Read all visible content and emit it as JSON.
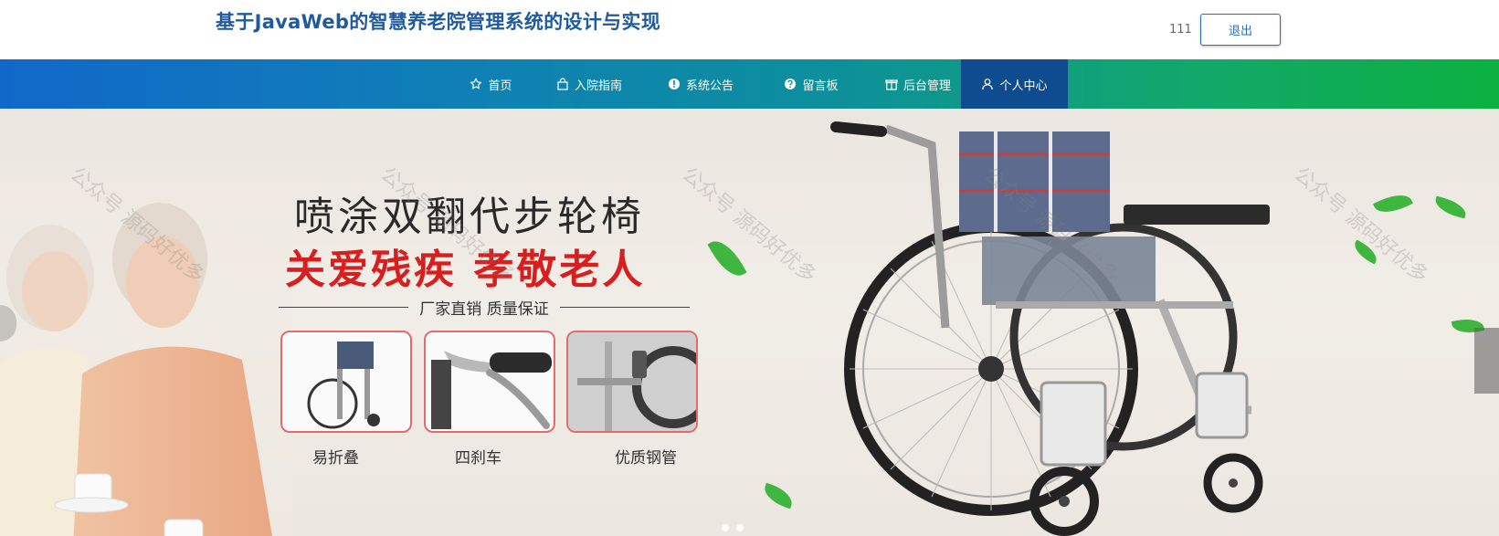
{
  "header": {
    "title": "基于JavaWeb的智慧养老院管理系统的设计与实现",
    "username": "111",
    "logout_label": "退出"
  },
  "nav": {
    "items": [
      {
        "label": "首页",
        "icon": "star-icon"
      },
      {
        "label": "入院指南",
        "icon": "bag-icon"
      },
      {
        "label": "系统公告",
        "icon": "info-circle-icon"
      },
      {
        "label": "留言板",
        "icon": "help-circle-icon"
      },
      {
        "label": "后台管理",
        "icon": "gift-box-icon"
      },
      {
        "label": "个人中心",
        "icon": "user-icon",
        "active": true
      }
    ]
  },
  "banner": {
    "headline": "喷涂双翻代步轮椅",
    "subheadline": "关爱残疾 孝敬老人",
    "tagline": "厂家直销 质量保证",
    "features": [
      {
        "label": "易折叠"
      },
      {
        "label": "四刹车"
      },
      {
        "label": "优质钢管"
      }
    ],
    "watermark": "公众号 源码好优多"
  },
  "colors": {
    "title": "#1f5a9e",
    "nav_start": "#1168c9",
    "nav_end": "#0bb040",
    "nav_active": "#0f4c8f",
    "subheadline": "#d81e1e"
  }
}
